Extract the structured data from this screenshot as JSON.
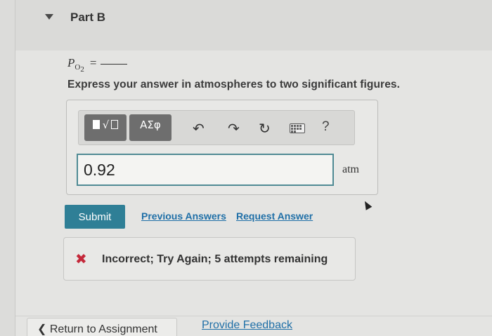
{
  "part": {
    "title": "Part B"
  },
  "question": {
    "symbol": "P",
    "subscript": "O",
    "subscript2": "2",
    "equals": "="
  },
  "instruction": "Express your answer in atmospheres to two significant figures.",
  "toolbar": {
    "math_template_label": "√",
    "greek_label": "ΑΣφ",
    "undo_icon": "↶",
    "redo_icon": "↷",
    "reset_icon": "↻",
    "help_label": "?"
  },
  "answer": {
    "value": "0.92",
    "unit": "atm"
  },
  "actions": {
    "submit_label": "Submit",
    "previous_answers_label": "Previous Answers",
    "request_answer_label": "Request Answer"
  },
  "feedback": {
    "icon": "✖",
    "message": "Incorrect; Try Again; 5 attempts remaining",
    "color": "#c4283a"
  },
  "footer": {
    "return_label": "Return to Assignment",
    "return_chevron": "❮",
    "provide_feedback_label": "Provide Feedback"
  },
  "colors": {
    "accent": "#2f7f96",
    "link": "#1f6fa7",
    "input_border": "#4f8a94"
  }
}
